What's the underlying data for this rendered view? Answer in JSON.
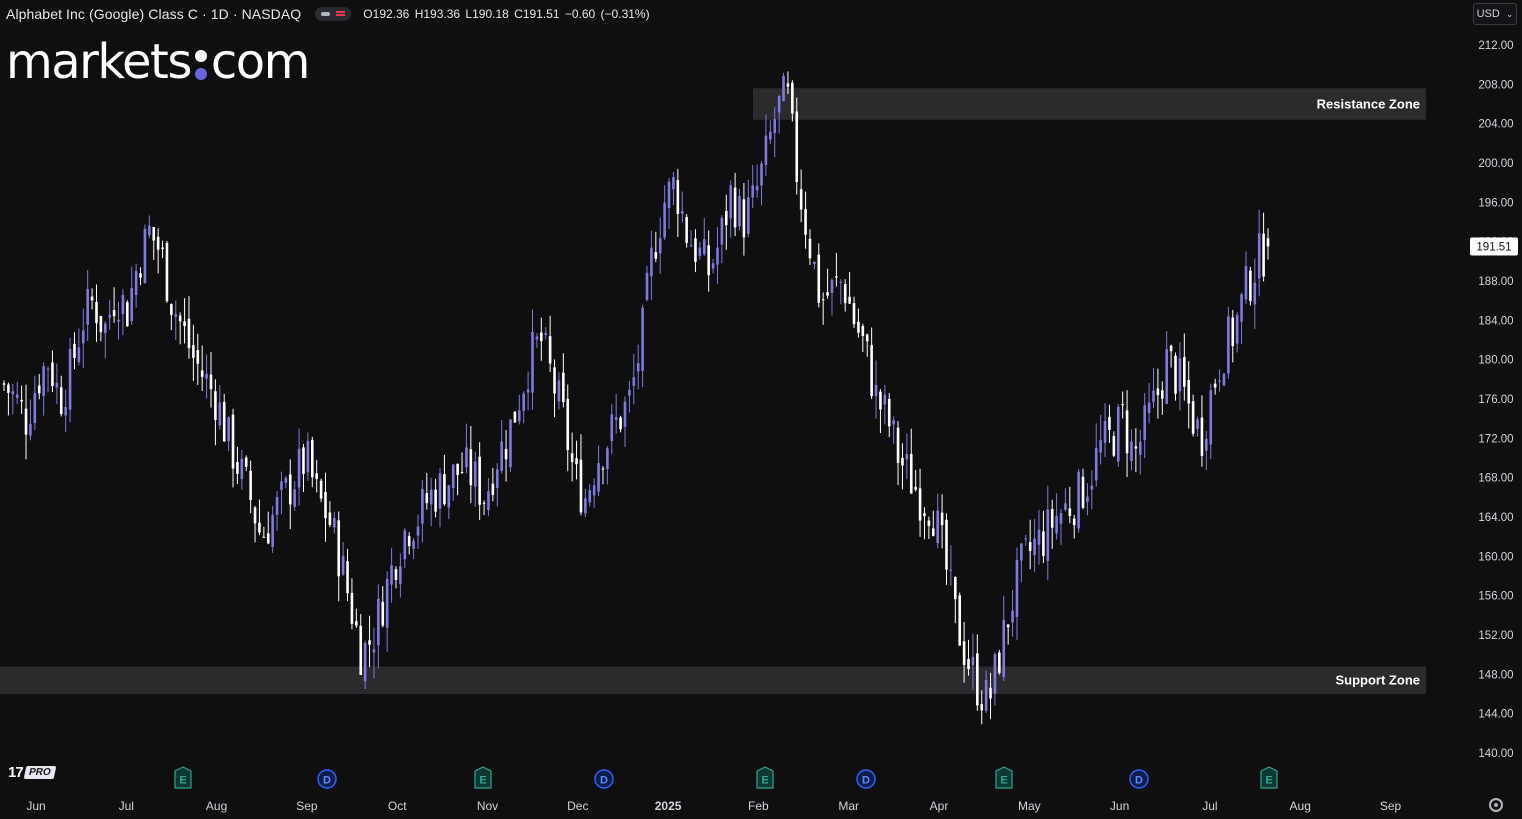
{
  "header": {
    "symbol_title": "Alphabet Inc (Google) Class C · 1D · NASDAQ",
    "open_label": "O",
    "open": "192.36",
    "high_label": "H",
    "high": "193.36",
    "low_label": "L",
    "low": "190.18",
    "close_label": "C",
    "close": "191.51",
    "change": "−0.60 (−0.31%)"
  },
  "currency": {
    "label": "USD",
    "icon": "chevron-down-icon"
  },
  "logo": {
    "left": "markets",
    "right": "com",
    "dot_color": "#6c63e0"
  },
  "tv_badge": {
    "mark": "17",
    "label": "PRO"
  },
  "colors": {
    "background": "#0f0f10",
    "up_candle": "#7e7adf",
    "down_candle": "#ffffff",
    "zone": "#2b2b2e",
    "text": "#d1d4dc"
  },
  "chart_data": {
    "type": "candlestick",
    "symbol": "Alphabet Inc (Google) Class C",
    "interval": "1D",
    "exchange": "NASDAQ",
    "ylim": [
      140,
      212
    ],
    "y_ticks": [
      "212.00",
      "208.00",
      "204.00",
      "200.00",
      "196.00",
      "192.00",
      "188.00",
      "184.00",
      "180.00",
      "176.00",
      "172.00",
      "168.00",
      "164.00",
      "160.00",
      "156.00",
      "152.00",
      "148.00",
      "144.00",
      "140.00"
    ],
    "x_ticks": [
      "Jun",
      "Jul",
      "Aug",
      "Sep",
      "Oct",
      "Nov",
      "Dec",
      "2025",
      "Feb",
      "Mar",
      "Apr",
      "May",
      "Jun",
      "Jul",
      "Aug",
      "Sep"
    ],
    "last_price_label": "191.51",
    "grid": false,
    "zones": [
      {
        "label": "Resistance Zone",
        "from": 204.4,
        "to": 207.6
      },
      {
        "label": "Support Zone",
        "from": 146.0,
        "to": 148.8
      }
    ],
    "closes_approx": [
      177.5,
      176,
      174,
      178,
      180,
      176,
      179,
      184,
      186,
      183,
      187,
      185,
      190,
      193,
      191,
      186,
      183,
      180,
      178,
      176,
      172,
      169,
      166,
      162,
      164,
      166,
      168,
      170,
      166,
      164,
      160,
      155,
      150,
      152,
      156,
      160,
      163,
      164,
      166,
      167,
      168,
      169,
      168,
      166,
      170,
      172,
      176,
      180,
      182,
      178,
      174,
      168,
      166,
      170,
      172,
      174,
      176,
      182,
      191,
      196,
      198,
      193,
      191,
      189,
      192,
      197,
      194,
      196,
      200,
      205,
      207,
      198,
      192,
      186,
      187,
      188,
      184,
      181,
      176,
      174,
      170,
      168,
      166,
      165,
      160,
      154,
      150,
      147,
      145,
      150,
      155,
      159,
      161,
      162,
      164,
      165,
      166,
      168,
      171,
      172,
      174,
      170,
      173,
      176,
      180,
      178,
      175,
      172,
      177,
      181,
      183,
      187,
      190,
      191.51
    ],
    "events": [
      {
        "kind": "E",
        "x_label": "Jul"
      },
      {
        "kind": "D",
        "x_label": "Sep"
      },
      {
        "kind": "E",
        "x_label": "Oct"
      },
      {
        "kind": "D",
        "x_label": "Dec"
      },
      {
        "kind": "E",
        "x_label": "Feb"
      },
      {
        "kind": "D",
        "x_label": "Mar"
      },
      {
        "kind": "E",
        "x_label": "Apr"
      },
      {
        "kind": "D",
        "x_label": "Jun"
      },
      {
        "kind": "E",
        "x_label": "Jul"
      }
    ]
  }
}
